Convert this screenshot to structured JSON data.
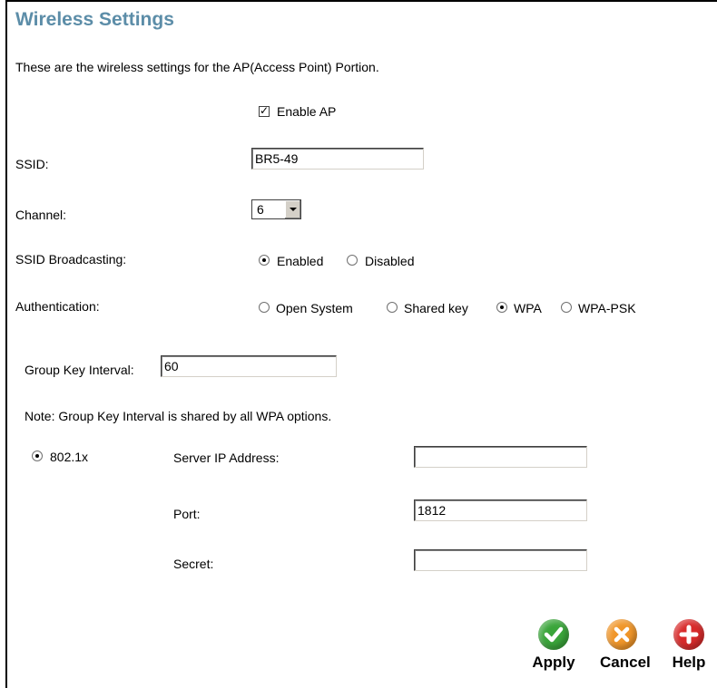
{
  "page": {
    "title": "Wireless Settings",
    "intro": "These are the wireless settings for the AP(Access Point) Portion."
  },
  "enable_ap": {
    "label": "Enable AP",
    "checked": true
  },
  "ssid": {
    "label": "SSID:",
    "value": "BR5-49"
  },
  "channel": {
    "label": "Channel:",
    "value": "6"
  },
  "ssid_broadcasting": {
    "label": "SSID Broadcasting:",
    "options": [
      {
        "label": "Enabled",
        "selected": true
      },
      {
        "label": "Disabled",
        "selected": false
      }
    ]
  },
  "authentication": {
    "label": "Authentication:",
    "options": [
      {
        "label": "Open System",
        "selected": false
      },
      {
        "label": "Shared key",
        "selected": false
      },
      {
        "label": "WPA",
        "selected": true
      },
      {
        "label": "WPA-PSK",
        "selected": false
      }
    ]
  },
  "group_key": {
    "label": "Group Key Interval:",
    "value": "60"
  },
  "note": "Note: Group Key Interval is shared by all WPA options.",
  "radius": {
    "mode_label": "802.1x",
    "server_ip": {
      "label": "Server IP Address:",
      "value": ""
    },
    "port": {
      "label": "Port:",
      "value": "1812"
    },
    "secret": {
      "label": "Secret:",
      "value": ""
    }
  },
  "actions": {
    "apply": {
      "label": "Apply",
      "icon": "check-icon",
      "color": "#3aa53a"
    },
    "cancel": {
      "label": "Cancel",
      "icon": "x-icon",
      "color": "#f0962a"
    },
    "help": {
      "label": "Help",
      "icon": "plus-icon",
      "color": "#d82b2b"
    }
  },
  "colors": {
    "title": "#5c8da8"
  }
}
